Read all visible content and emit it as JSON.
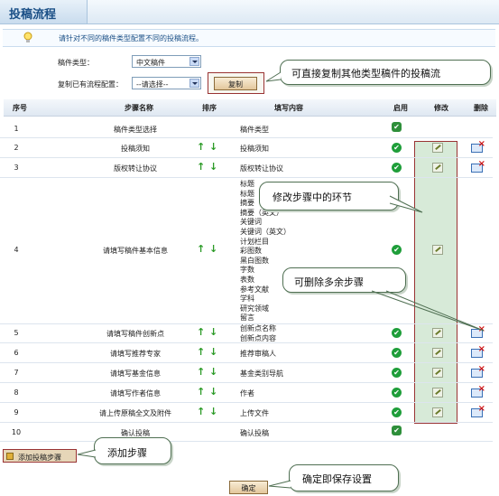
{
  "page": {
    "title": "投稿流程"
  },
  "tip": {
    "text": "请针对不同的稿件类型配置不同的投稿流程。"
  },
  "form": {
    "type_label": "稿件类型：",
    "type_value": "中文稿件",
    "copy_label": "复制已有流程配置：",
    "copy_value": "--请选择--",
    "copy_button": "复制"
  },
  "table": {
    "headers": {
      "idx": "序号",
      "name": "步骤名称",
      "sort": "排序",
      "content": "填写内容",
      "enabled": "启用",
      "edit": "修改",
      "delete": "删除"
    },
    "rows": [
      {
        "idx": "1",
        "name": "稿件类型选择",
        "content": "稿件类型"
      },
      {
        "idx": "2",
        "name": "投稿须知",
        "content": "投稿须知"
      },
      {
        "idx": "3",
        "name": "版权转让协议",
        "content": "版权转让协议"
      },
      {
        "idx": "4",
        "name": "请填写稿件基本信息",
        "content_lines": [
          "标题",
          "标题",
          "摘要",
          "摘要（英文）",
          "关键词",
          "关键词（英文）",
          "计划栏目",
          "彩图数",
          "黑白图数",
          "字数",
          "表数",
          "参考文献",
          "学科",
          "研究领域",
          "留言"
        ]
      },
      {
        "idx": "5",
        "name": "请填写稿件创新点",
        "content_lines": [
          "创新点名称",
          "创新点内容"
        ]
      },
      {
        "idx": "6",
        "name": "请填写推荐专家",
        "content": "推荐审稿人"
      },
      {
        "idx": "7",
        "name": "请填写基金信息",
        "content": "基金类别导航"
      },
      {
        "idx": "8",
        "name": "请填写作者信息",
        "content": "作者"
      },
      {
        "idx": "9",
        "name": "请上传原稿全文及附件",
        "content": "上传文件"
      },
      {
        "idx": "10",
        "name": "确认投稿",
        "content": "确认投稿"
      }
    ]
  },
  "actions": {
    "add_step": "添加投稿步骤",
    "confirm": "确定"
  },
  "callouts": {
    "copy": "可直接复制其他类型稿件的投稿流",
    "edit": "修改步骤中的环节",
    "delete": "可删除多余步骤",
    "add": "添加步骤",
    "save": "确定即保存设置"
  },
  "icons": {
    "up": "↑",
    "down": "↓",
    "check": "✔"
  },
  "colors": {
    "accent": "#1a4f86",
    "highlight_border": "#993333",
    "check_green": "#1f9e3a"
  }
}
